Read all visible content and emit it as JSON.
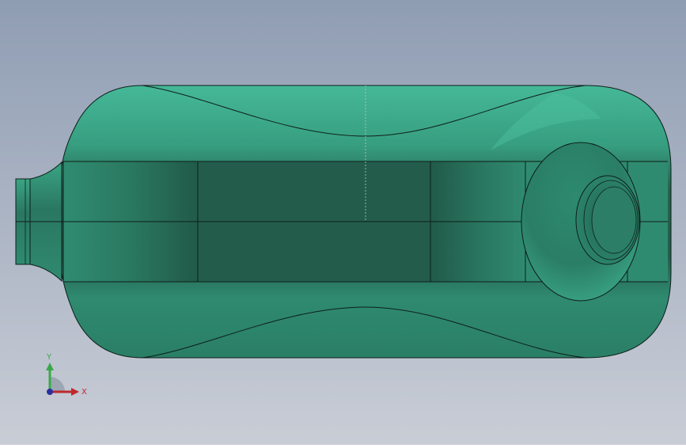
{
  "viewport": {
    "background_top": "#8f9db3",
    "background_bottom": "#c9cdd6",
    "model_color": "#2e8d72",
    "edge_color": "#0d1f18"
  },
  "triad": {
    "y_label": "Y",
    "x_label": "X",
    "y_color": "#3aa84a",
    "x_color": "#c0282b",
    "z_color": "#2a2f9e"
  }
}
